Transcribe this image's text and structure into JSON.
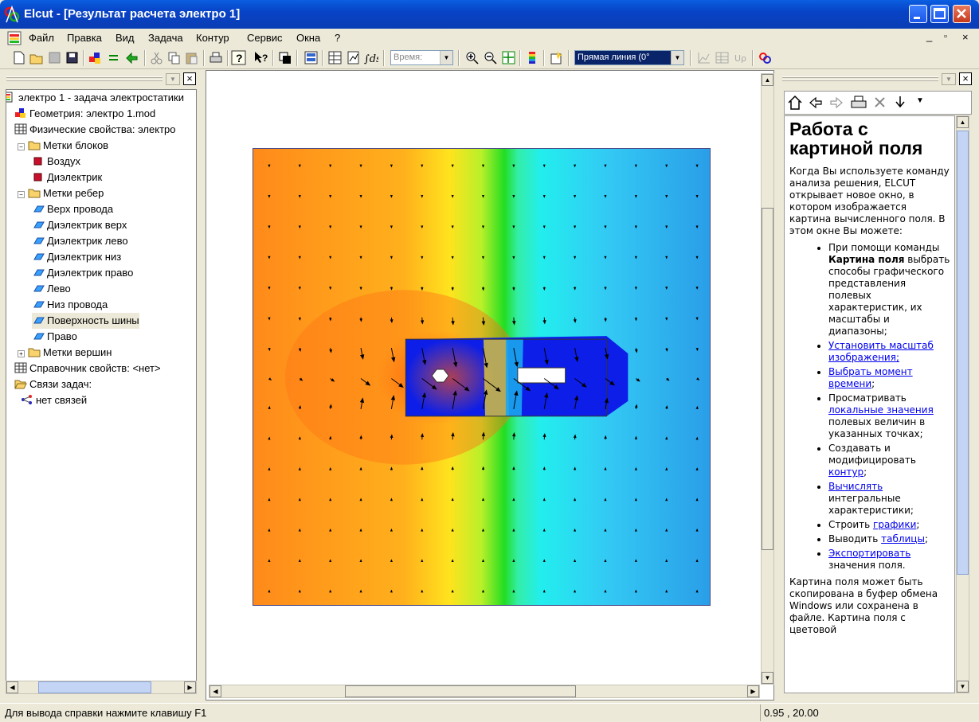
{
  "window": {
    "title": "Elcut - [Результат расчета электро 1]"
  },
  "menu": [
    "Файл",
    "Правка",
    "Вид",
    "Задача",
    "Контур",
    "Сервис",
    "Окна",
    "?"
  ],
  "toolbar": {
    "time_label": "Время:",
    "contour_mode": "Прямая линия (0°"
  },
  "tree": {
    "items": [
      {
        "label": "электро 1 - задача электростатики",
        "indent": 0,
        "icon": "problem-icon"
      },
      {
        "label": "Геометрия: электро 1.mod",
        "indent": 1,
        "icon": "geometry-icon"
      },
      {
        "label": "Физические свойства: электро",
        "indent": 1,
        "icon": "table-icon"
      },
      {
        "label": "Метки блоков",
        "indent": 2,
        "icon": "folder-icon"
      },
      {
        "label": "Воздух",
        "indent": 3,
        "icon": "block-label-icon"
      },
      {
        "label": "Диэлектрик",
        "indent": 3,
        "icon": "block-label-icon"
      },
      {
        "label": "Метки ребер",
        "indent": 2,
        "icon": "folder-icon"
      },
      {
        "label": "Верх провода",
        "indent": 3,
        "icon": "edge-label-icon"
      },
      {
        "label": "Диэлектрик верх",
        "indent": 3,
        "icon": "edge-label-icon"
      },
      {
        "label": "Диэлектрик лево",
        "indent": 3,
        "icon": "edge-label-icon"
      },
      {
        "label": "Диэлектрик низ",
        "indent": 3,
        "icon": "edge-label-icon"
      },
      {
        "label": "Диэлектрик право",
        "indent": 3,
        "icon": "edge-label-icon"
      },
      {
        "label": "Лево",
        "indent": 3,
        "icon": "edge-label-icon"
      },
      {
        "label": "Низ провода",
        "indent": 3,
        "icon": "edge-label-icon"
      },
      {
        "label": "Поверхность шины",
        "indent": 3,
        "icon": "edge-label-icon"
      },
      {
        "label": "Право",
        "indent": 3,
        "icon": "edge-label-icon"
      },
      {
        "label": "Метки вершин",
        "indent": 2,
        "icon": "folder-icon"
      },
      {
        "label": "Справочник свойств: <нет>",
        "indent": 1,
        "icon": "table-icon"
      },
      {
        "label": "Связи задач:",
        "indent": 1,
        "icon": "folder-open-icon"
      },
      {
        "label": "нет связей",
        "indent": 2,
        "icon": "link-icon"
      }
    ]
  },
  "help": {
    "title": "Работа с картиной поля",
    "intro": "Когда Вы используете команду анализа решения, ELCUT открывает новое окно, в котором изображается картина вычисленного поля. В этом окне Вы можете:",
    "b1_pre": "При помощи команды ",
    "b1_bold": "Картина поля",
    "b1_post": " выбрать способы графического представления полевых характеристик, их масштабы и диапазоны;",
    "b2_link": "Установить масштаб изображения;",
    "b3_link": "Выбрать момент времени",
    "b3_post": ";",
    "b4_pre": "Просматривать ",
    "b4_link": "локальные значения",
    "b4_post": " полевых величин в указанных точках;",
    "b5_pre": "Создавать и модифицировать ",
    "b5_link": "контур",
    "b5_post": ";",
    "b6_link": "Вычислять",
    "b6_post": " интегральные характеристики;",
    "b7_pre": "Строить ",
    "b7_link": "графики",
    "b7_post": ";",
    "b8_pre": "Выводить ",
    "b8_link": "таблицы",
    "b8_post": ";",
    "b9_link": "Экспортировать",
    "b9_post": " значения поля.",
    "outro": "Картина поля может быть скопирована в буфер обмена Windows или сохранена в файле. Картина поля с цветовой"
  },
  "status": {
    "hint": "Для вывода справки нажмите клавишу F1",
    "coords": "0.95 , 20.00"
  },
  "colors": {
    "title_bar": "#0a4fd6",
    "field_left": "#ff8a1a",
    "field_center": "#33dd22",
    "field_right": "#1e9be8",
    "conductor": "#0c1ee8"
  }
}
